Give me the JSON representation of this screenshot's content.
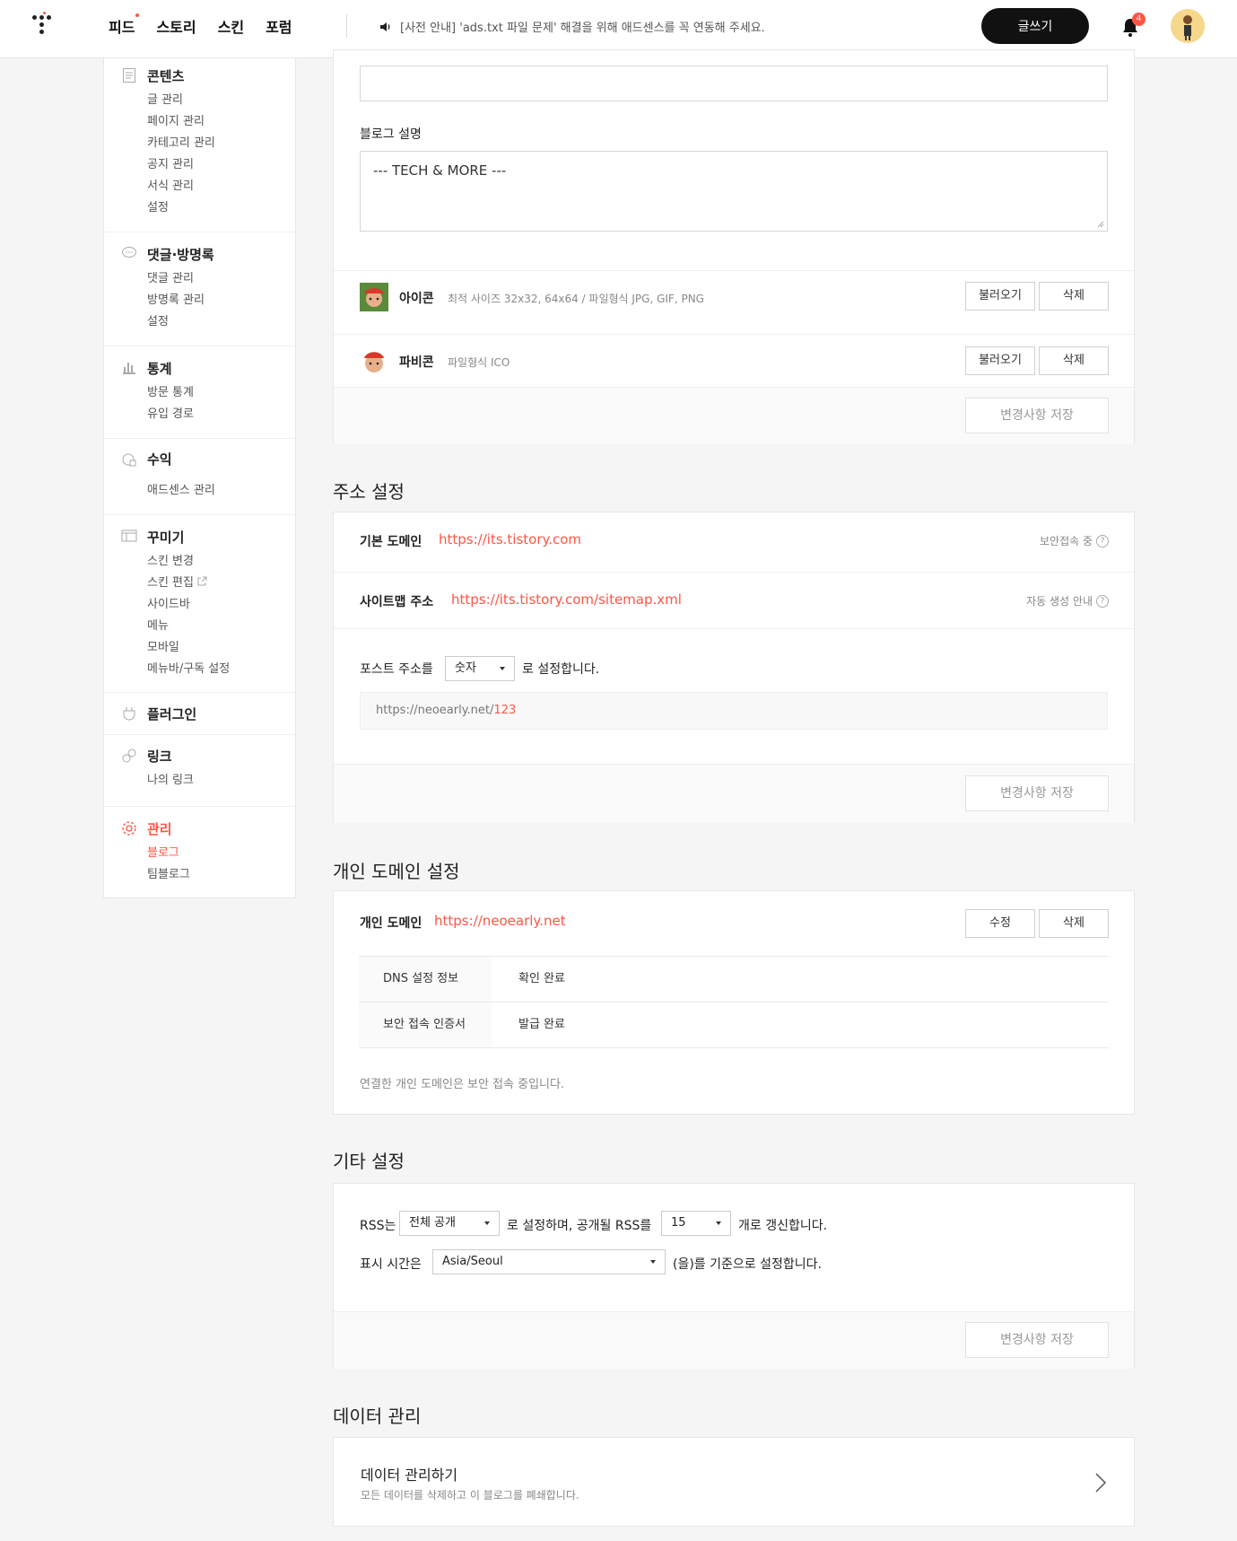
{
  "topbar": {
    "nav": [
      "피드",
      "스토리",
      "스킨",
      "포럼"
    ],
    "notice": "[사전 안내] 'ads.txt 파일 문제' 해결을 위해 애드센스를 꼭 연동해 주세요.",
    "write_label": "글쓰기",
    "notification_count": "4"
  },
  "sidebar": {
    "groups": [
      {
        "title": "콘텐츠",
        "icon": "document-icon",
        "items": [
          "글 관리",
          "페이지 관리",
          "카테고리 관리",
          "공지 관리",
          "서식 관리",
          "설정"
        ]
      },
      {
        "title": "댓글·방명록",
        "icon": "speech-bubble-icon",
        "items": [
          "댓글 관리",
          "방명록 관리",
          "설정"
        ]
      },
      {
        "title": "통계",
        "icon": "bar-chart-icon",
        "items": [
          "방문 통계",
          "유입 경로"
        ]
      },
      {
        "title": "수익",
        "icon": "coin-icon",
        "items": [
          "애드센스 관리"
        ]
      },
      {
        "title": "꾸미기",
        "icon": "layout-icon",
        "items": [
          "스킨 변경",
          "스킨 편집",
          "사이드바",
          "메뉴",
          "모바일",
          "메뉴바/구독 설정"
        ]
      },
      {
        "title": "플러그인",
        "icon": "plug-icon",
        "items": []
      },
      {
        "title": "링크",
        "icon": "link-icon",
        "items": [
          "나의 링크"
        ]
      },
      {
        "title": "관리",
        "icon": "gear-icon",
        "items": [
          "블로그",
          "팀블로그"
        ]
      }
    ]
  },
  "blog_info": {
    "desc_label": "블로그 설명",
    "desc_value": "--- TECH & MORE ---",
    "icon_label": "아이콘",
    "icon_hint": "최적 사이즈 32x32, 64x64 / 파일형식 JPG, GIF, PNG",
    "favicon_label": "파비콘",
    "favicon_hint": "파일형식 ICO",
    "load_label": "불러오기",
    "delete_label": "삭제",
    "save_label": "변경사항 저장"
  },
  "address": {
    "heading": "주소 설정",
    "domain_label": "기본 도메인",
    "domain_value": "https://its.tistory.com",
    "domain_help": "보안접속 중",
    "sitemap_label": "사이트맵 주소",
    "sitemap_value": "https://its.tistory.com/sitemap.xml",
    "sitemap_help": "자동 생성 안내",
    "post_prefix": "포스트 주소를",
    "post_select": "숫자",
    "post_suffix": "로 설정합니다.",
    "preview_base": "https://neoearly.net/",
    "preview_num": "123",
    "save_label": "변경사항 저장"
  },
  "custom_domain": {
    "heading": "개인 도메인 설정",
    "label": "개인 도메인",
    "value": "https://neoearly.net",
    "edit_label": "수정",
    "delete_label": "삭제",
    "rows": [
      {
        "key": "DNS 설정 정보",
        "value": "확인 완료"
      },
      {
        "key": "보안 접속 인증서",
        "value": "발급 완료"
      }
    ],
    "note": "연결한 개인 도메인은 보안 접속 중입니다."
  },
  "etc": {
    "heading": "기타 설정",
    "rss_prefix": "RSS는",
    "rss_select": "전체 공개",
    "rss_middle": "로 설정하며, 공개될 RSS를",
    "rss_count": "15",
    "rss_suffix": "개로 갱신합니다.",
    "time_prefix": "표시 시간은",
    "time_select": "Asia/Seoul",
    "time_suffix": "(을)를 기준으로 설정합니다.",
    "save_label": "변경사항 저장"
  },
  "data": {
    "heading": "데이터 관리",
    "title": "데이터 관리하기",
    "desc": "모든 데이터를 삭제하고 이 블로그를 폐쇄합니다."
  }
}
